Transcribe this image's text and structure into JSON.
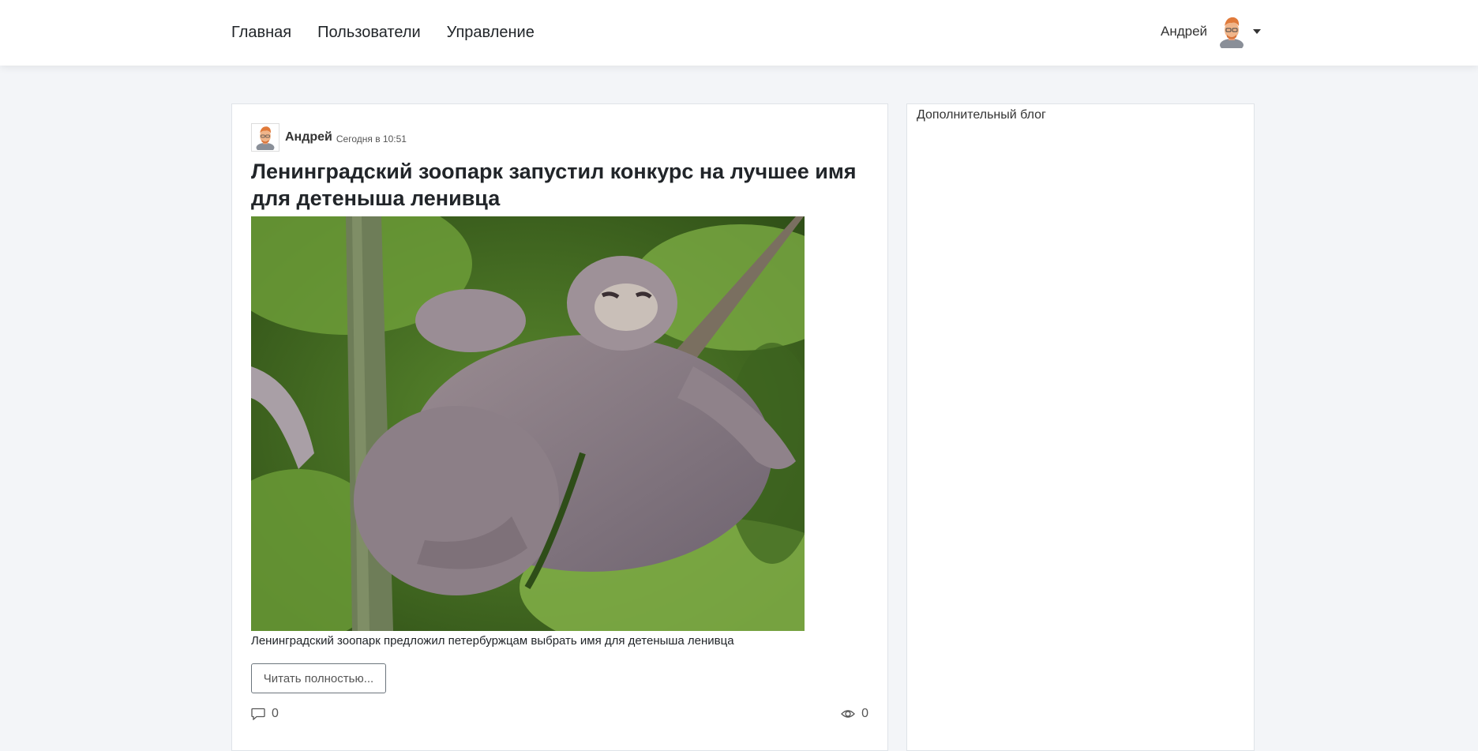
{
  "nav": {
    "items": [
      {
        "label": "Главная"
      },
      {
        "label": "Пользователи"
      },
      {
        "label": "Управление"
      }
    ]
  },
  "user": {
    "name": "Андрей"
  },
  "post": {
    "author": "Андрей",
    "date": "Сегодня в 10:51",
    "title": "Ленинградский зоопарк запустил конкурс на лучшее имя для детеныша ленивца",
    "description": "Ленинградский зоопарк предложил петербуржцам выбрать имя для детеныша ленивца",
    "read_more": "Читать полностью...",
    "comments_count": "0",
    "views_count": "0",
    "image": "sloth-photo"
  },
  "sidebar": {
    "title": "Дополнительный блог"
  },
  "colors": {
    "background": "#f3f5f8",
    "card": "#ffffff",
    "text": "#212529"
  }
}
